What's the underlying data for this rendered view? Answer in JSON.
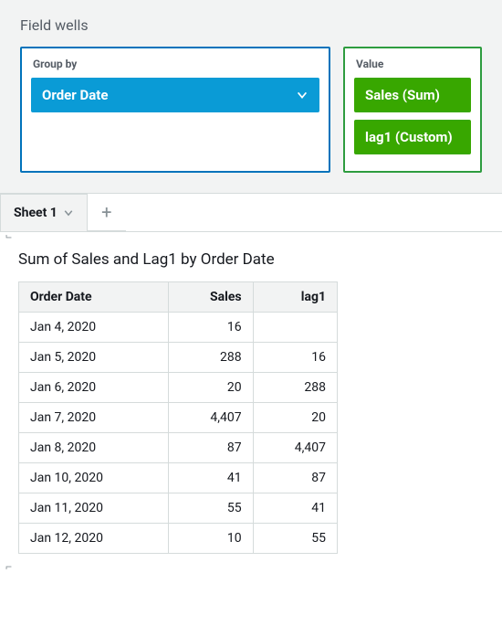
{
  "field_wells": {
    "title": "Field wells",
    "group_by": {
      "label": "Group by",
      "items": [
        {
          "label": "Order Date"
        }
      ]
    },
    "value": {
      "label": "Value",
      "items": [
        {
          "label": "Sales (Sum)"
        },
        {
          "label": "lag1 (Custom)"
        }
      ]
    }
  },
  "tabs": {
    "items": [
      {
        "label": "Sheet 1"
      }
    ]
  },
  "chart_data": {
    "type": "table",
    "title": "Sum of Sales and Lag1 by Order Date",
    "columns": [
      "Order Date",
      "Sales",
      "lag1"
    ],
    "rows": [
      {
        "date": "Jan 4, 2020",
        "sales": "16",
        "lag1": ""
      },
      {
        "date": "Jan 5, 2020",
        "sales": "288",
        "lag1": "16"
      },
      {
        "date": "Jan 6, 2020",
        "sales": "20",
        "lag1": "288"
      },
      {
        "date": "Jan 7, 2020",
        "sales": "4,407",
        "lag1": "20"
      },
      {
        "date": "Jan 8, 2020",
        "sales": "87",
        "lag1": "4,407"
      },
      {
        "date": "Jan 10, 2020",
        "sales": "41",
        "lag1": "87"
      },
      {
        "date": "Jan 11, 2020",
        "sales": "55",
        "lag1": "41"
      },
      {
        "date": "Jan 12, 2020",
        "sales": "10",
        "lag1": "55"
      }
    ]
  }
}
